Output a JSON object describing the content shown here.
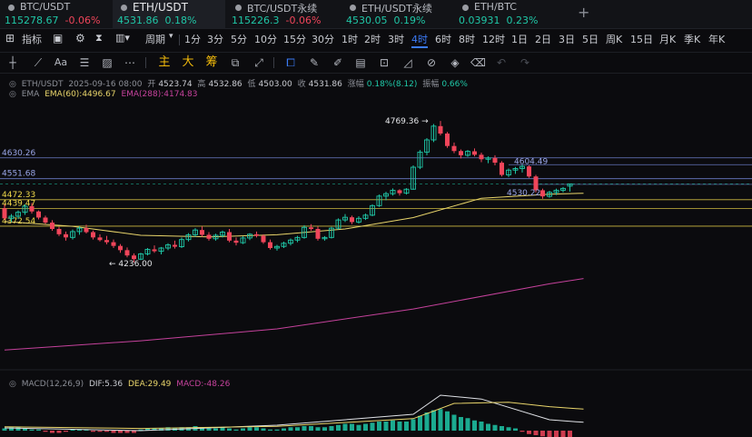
{
  "tabs": [
    {
      "symbol": "BTC/USDT",
      "price": "115278.67",
      "change": "-0.06%",
      "active": false
    },
    {
      "symbol": "ETH/USDT",
      "price": "4531.86",
      "change": "0.18%",
      "active": true
    },
    {
      "symbol": "BTC/USDT永续",
      "price": "115226.3",
      "change": "-0.06%",
      "active": false
    },
    {
      "symbol": "ETH/USDT永续",
      "price": "4530.05",
      "change": "0.19%",
      "active": false
    },
    {
      "symbol": "ETH/BTC",
      "price": "0.03931",
      "change": "0.23%",
      "active": false
    }
  ],
  "toolbar": {
    "indicators_label": "指标",
    "period_label": "周期",
    "periods": [
      "1分",
      "3分",
      "5分",
      "10分",
      "15分",
      "30分",
      "1时",
      "2时",
      "3时",
      "4时",
      "6时",
      "8时",
      "12时",
      "1日",
      "2日",
      "3日",
      "5日",
      "周K",
      "15日",
      "月K",
      "季K",
      "年K"
    ],
    "active_period": "4时"
  },
  "drawing_tools": {
    "cn_labels": [
      "主",
      "大",
      "筹"
    ]
  },
  "ohlc": {
    "symbol": "ETH/USDT",
    "datetime": "2025-09-16 08:00",
    "open_label": "开",
    "open": "4523.74",
    "high_label": "高",
    "high": "4532.86",
    "low_label": "低",
    "low": "4503.00",
    "close_label": "收",
    "close": "4531.86",
    "change_label": "涨幅",
    "change": "0.18%(8.12)",
    "amplitude_label": "振幅",
    "amplitude": "0.66%"
  },
  "ema": {
    "label": "EMA",
    "ema60": "EMA(60):4496.67",
    "ema288": "EMA(288):4174.83"
  },
  "macd": {
    "label": "MACD(12,26,9)",
    "dif": "DIF:5.36",
    "dea": "DEA:29.49",
    "macd": "MACD:-48.26"
  },
  "price_lines": [
    "4630.26",
    "4551.68",
    "4472.33",
    "4439.47",
    "4372.54"
  ],
  "price_annotations": {
    "high": "4769.36",
    "low": "4236.00",
    "alert1": "4604.49",
    "alert2": "4530.22"
  },
  "colors": {
    "up": "#1fc7a7",
    "down": "#f0455a",
    "ema60": "#e9d56b",
    "ema288": "#c5429c",
    "accent": "#3b7bf7",
    "level_line": "#f0d94a",
    "blue_line": "#7c8fe8"
  },
  "chart_data": {
    "type": "candlestick",
    "interval": "4h",
    "y_unit": "USDT",
    "candles": [
      [
        4440,
        4455,
        4395,
        4402
      ],
      [
        4402,
        4418,
        4388,
        4410
      ],
      [
        4410,
        4432,
        4400,
        4425
      ],
      [
        4425,
        4455,
        4415,
        4448
      ],
      [
        4448,
        4460,
        4420,
        4428
      ],
      [
        4428,
        4432,
        4398,
        4405
      ],
      [
        4405,
        4412,
        4380,
        4386
      ],
      [
        4386,
        4395,
        4355,
        4362
      ],
      [
        4362,
        4370,
        4335,
        4342
      ],
      [
        4342,
        4352,
        4318,
        4330
      ],
      [
        4330,
        4360,
        4322,
        4352
      ],
      [
        4352,
        4372,
        4340,
        4365
      ],
      [
        4365,
        4378,
        4345,
        4350
      ],
      [
        4350,
        4356,
        4322,
        4330
      ],
      [
        4330,
        4342,
        4315,
        4320
      ],
      [
        4320,
        4336,
        4304,
        4312
      ],
      [
        4312,
        4322,
        4290,
        4298
      ],
      [
        4298,
        4305,
        4272,
        4282
      ],
      [
        4282,
        4292,
        4255,
        4262
      ],
      [
        4262,
        4270,
        4236,
        4248
      ],
      [
        4248,
        4272,
        4244,
        4268
      ],
      [
        4268,
        4290,
        4262,
        4285
      ],
      [
        4285,
        4300,
        4272,
        4278
      ],
      [
        4278,
        4294,
        4266,
        4290
      ],
      [
        4290,
        4308,
        4282,
        4302
      ],
      [
        4302,
        4318,
        4288,
        4295
      ],
      [
        4295,
        4330,
        4290,
        4322
      ],
      [
        4322,
        4346,
        4315,
        4340
      ],
      [
        4340,
        4365,
        4332,
        4358
      ],
      [
        4358,
        4372,
        4332,
        4340
      ],
      [
        4340,
        4350,
        4318,
        4325
      ],
      [
        4325,
        4344,
        4318,
        4338
      ],
      [
        4338,
        4356,
        4330,
        4350
      ],
      [
        4350,
        4362,
        4312,
        4318
      ],
      [
        4318,
        4330,
        4300,
        4310
      ],
      [
        4310,
        4334,
        4305,
        4328
      ],
      [
        4328,
        4346,
        4320,
        4342
      ],
      [
        4342,
        4352,
        4330,
        4336
      ],
      [
        4336,
        4342,
        4306,
        4312
      ],
      [
        4312,
        4322,
        4284,
        4290
      ],
      [
        4290,
        4302,
        4280,
        4296
      ],
      [
        4296,
        4314,
        4290,
        4308
      ],
      [
        4308,
        4326,
        4300,
        4320
      ],
      [
        4320,
        4336,
        4312,
        4330
      ],
      [
        4330,
        4376,
        4325,
        4368
      ],
      [
        4368,
        4380,
        4355,
        4362
      ],
      [
        4362,
        4372,
        4318,
        4325
      ],
      [
        4325,
        4335,
        4318,
        4330
      ],
      [
        4330,
        4370,
        4326,
        4365
      ],
      [
        4365,
        4402,
        4360,
        4396
      ],
      [
        4396,
        4418,
        4388,
        4406
      ],
      [
        4406,
        4412,
        4380,
        4388
      ],
      [
        4388,
        4410,
        4382,
        4402
      ],
      [
        4402,
        4420,
        4396,
        4414
      ],
      [
        4414,
        4455,
        4410,
        4450
      ],
      [
        4450,
        4492,
        4445,
        4486
      ],
      [
        4486,
        4502,
        4470,
        4495
      ],
      [
        4495,
        4515,
        4488,
        4508
      ],
      [
        4508,
        4512,
        4488,
        4497
      ],
      [
        4497,
        4516,
        4492,
        4512
      ],
      [
        4512,
        4602,
        4510,
        4595
      ],
      [
        4595,
        4660,
        4588,
        4652
      ],
      [
        4652,
        4705,
        4640,
        4698
      ],
      [
        4698,
        4758,
        4690,
        4750
      ],
      [
        4750,
        4769.36,
        4715,
        4722
      ],
      [
        4722,
        4728,
        4668,
        4675
      ],
      [
        4675,
        4688,
        4648,
        4656
      ],
      [
        4656,
        4662,
        4628,
        4640
      ],
      [
        4640,
        4660,
        4634,
        4655
      ],
      [
        4655,
        4666,
        4636,
        4642
      ],
      [
        4642,
        4650,
        4614,
        4625
      ],
      [
        4625,
        4636,
        4610,
        4630
      ],
      [
        4630,
        4640,
        4602,
        4612
      ],
      [
        4612,
        4618,
        4560,
        4566
      ],
      [
        4566,
        4590,
        4558,
        4584
      ],
      [
        4584,
        4596,
        4570,
        4590
      ],
      [
        4590,
        4604.49,
        4575,
        4598
      ],
      [
        4598,
        4602,
        4555,
        4560
      ],
      [
        4560,
        4566,
        4500,
        4508
      ],
      [
        4508,
        4514,
        4476,
        4485
      ],
      [
        4485,
        4506,
        4480,
        4500
      ],
      [
        4500,
        4514,
        4490,
        4508
      ],
      [
        4508,
        4520,
        4500,
        4515
      ],
      [
        4523.74,
        4532.86,
        4503,
        4531.86
      ]
    ],
    "ema60": [
      [
        0,
        4390
      ],
      [
        10,
        4372
      ],
      [
        20,
        4338
      ],
      [
        30,
        4332
      ],
      [
        40,
        4340
      ],
      [
        50,
        4362
      ],
      [
        60,
        4405
      ],
      [
        70,
        4478
      ],
      [
        80,
        4493
      ],
      [
        85,
        4496.67
      ]
    ],
    "ema288": [
      [
        0,
        3905
      ],
      [
        20,
        3940
      ],
      [
        40,
        3985
      ],
      [
        60,
        4060
      ],
      [
        80,
        4155
      ],
      [
        85,
        4174.83
      ]
    ],
    "levels": [
      4630.26,
      4551.68,
      4472.33,
      4439.47,
      4372.54
    ],
    "macd_panel": {
      "histogram": [
        2,
        3,
        3,
        2,
        1,
        1,
        -1,
        -2,
        -2,
        -1,
        1,
        1,
        1,
        -1,
        -1,
        -1,
        -2,
        -2,
        -2,
        -2,
        1,
        2,
        2,
        2,
        3,
        2,
        3,
        3,
        4,
        3,
        2,
        2,
        3,
        2,
        1,
        2,
        3,
        3,
        2,
        1,
        1,
        2,
        3,
        3,
        4,
        4,
        3,
        3,
        4,
        5,
        6,
        6,
        5,
        6,
        7,
        8,
        8,
        9,
        8,
        8,
        10,
        13,
        16,
        18,
        19,
        17,
        14,
        12,
        11,
        9,
        8,
        6,
        5,
        4,
        3,
        2,
        -1,
        -3,
        -4,
        -5,
        -6,
        -7,
        -7,
        -6
      ],
      "dif": [
        [
          0,
          -5
        ],
        [
          20,
          -10
        ],
        [
          40,
          0
        ],
        [
          60,
          20
        ],
        [
          64,
          55
        ],
        [
          70,
          48
        ],
        [
          80,
          10
        ],
        [
          85,
          5.36
        ]
      ],
      "dea": [
        [
          0,
          -3
        ],
        [
          20,
          -6
        ],
        [
          40,
          -2
        ],
        [
          60,
          12
        ],
        [
          66,
          40
        ],
        [
          74,
          42
        ],
        [
          80,
          34
        ],
        [
          85,
          29.49
        ]
      ]
    }
  }
}
